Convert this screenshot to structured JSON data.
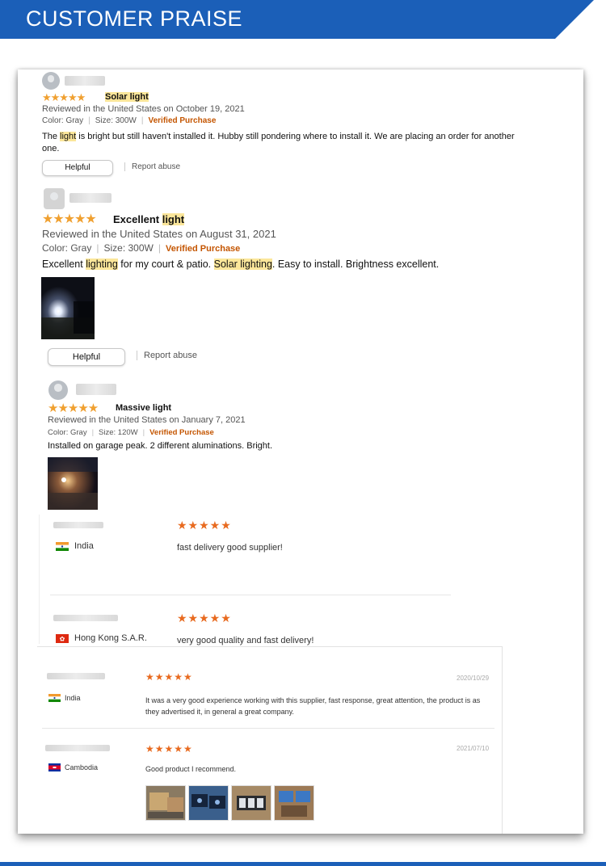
{
  "banner": {
    "title": "CUSTOMER PRAISE"
  },
  "amazon_reviews": [
    {
      "stars": "★★★★★",
      "title_parts": [
        {
          "text": "Solar light",
          "hl": true
        }
      ],
      "reviewed": "Reviewed in the United States on October 19, 2021",
      "color": "Color: Gray",
      "size": "Size: 300W",
      "verified": "Verified Purchase",
      "body_parts": [
        {
          "text": "The ",
          "hl": false
        },
        {
          "text": "light",
          "hl": true
        },
        {
          "text": " is bright but still haven't installed it. Hubby still pondering where to install it. We are placing an order for another one.",
          "hl": false
        }
      ],
      "helpful": "Helpful",
      "report": "Report abuse"
    },
    {
      "stars": "★★★★★",
      "title_parts": [
        {
          "text": "Excellent ",
          "hl": false
        },
        {
          "text": "light",
          "hl": true
        }
      ],
      "reviewed": "Reviewed in the United States on August 31, 2021",
      "color": "Color: Gray",
      "size": "Size: 300W",
      "verified": "Verified Purchase",
      "body_parts": [
        {
          "text": "Excellent ",
          "hl": false
        },
        {
          "text": "lighting",
          "hl": true
        },
        {
          "text": " for my court & patio. ",
          "hl": false
        },
        {
          "text": "Solar lighting",
          "hl": true
        },
        {
          "text": ". Easy to install. Brightness excellent.",
          "hl": false
        }
      ],
      "helpful": "Helpful",
      "report": "Report abuse"
    },
    {
      "stars": "★★★★★",
      "title_parts": [
        {
          "text": "Massive light",
          "hl": false
        }
      ],
      "reviewed": "Reviewed in the United States on January 7, 2021",
      "color": "Color: Gray",
      "size": "Size: 120W",
      "verified": "Verified Purchase",
      "body_parts": [
        {
          "text": "Installed on garage peak. 2 different aluminations. Bright.",
          "hl": false
        }
      ]
    }
  ],
  "supplier_reviews": [
    {
      "stars": "★★★★★",
      "country": "India",
      "flag": "india",
      "comment": "fast delivery good supplier!"
    },
    {
      "stars": "★★★★★",
      "country": "Hong Kong S.A.R.",
      "flag": "hongkong",
      "comment": "very good quality and fast delivery!"
    },
    {
      "stars": "★★★★★",
      "country": "India",
      "flag": "india",
      "date": "2020/10/29",
      "comment": "It was a very good experience working with this supplier, fast response, great attention, the product is as they advertised it, in general a great company."
    },
    {
      "stars": "★★★★★",
      "country": "Cambodia",
      "flag": "cambodia",
      "date": "2021/07/10",
      "comment": "Good product I recommend."
    }
  ],
  "colors": {
    "banner": "#1b5fb8",
    "star": "#f0a030",
    "star_alibaba": "#e86a1f",
    "verified": "#c45500",
    "highlight": "#fbe69a"
  }
}
